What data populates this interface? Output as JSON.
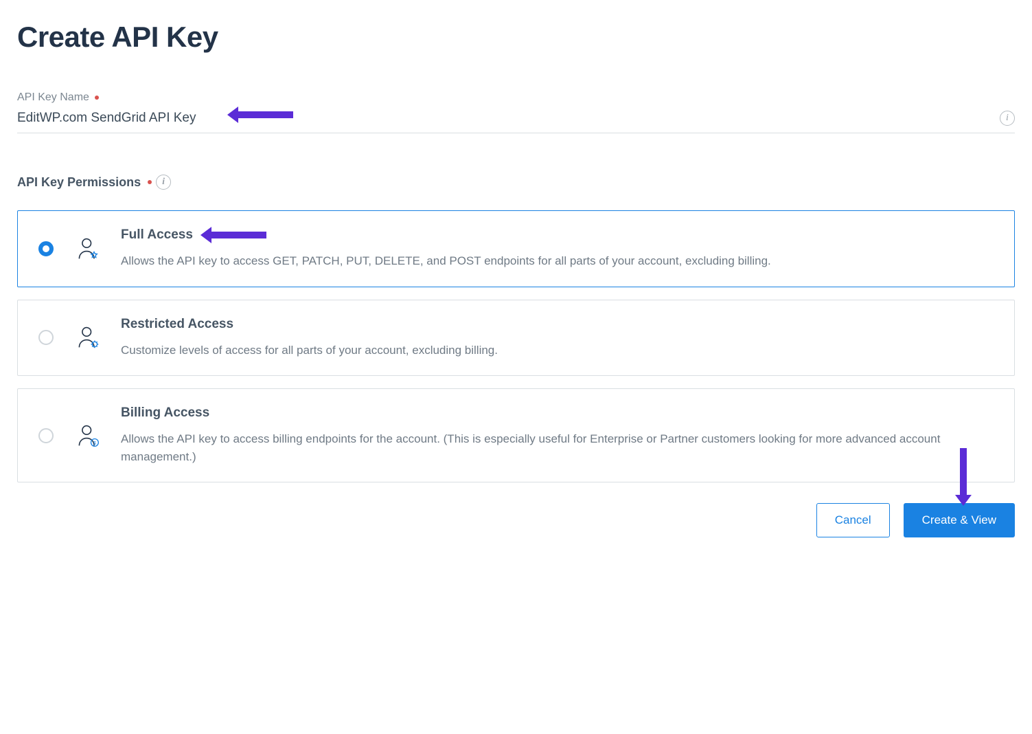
{
  "page": {
    "title": "Create API Key"
  },
  "fields": {
    "name_label": "API Key Name",
    "name_value": "EditWP.com SendGrid API Key"
  },
  "permissions": {
    "section_label": "API Key Permissions",
    "options": [
      {
        "id": "full",
        "title": "Full Access",
        "description": "Allows the API key to access GET, PATCH, PUT, DELETE, and POST endpoints for all parts of your account, excluding billing.",
        "selected": true
      },
      {
        "id": "restricted",
        "title": "Restricted Access",
        "description": "Customize levels of access for all parts of your account, excluding billing.",
        "selected": false
      },
      {
        "id": "billing",
        "title": "Billing Access",
        "description": "Allows the API key to access billing endpoints for the account. (This is especially useful for Enterprise or Partner customers looking for more advanced account management.)",
        "selected": false
      }
    ]
  },
  "actions": {
    "cancel": "Cancel",
    "create": "Create & View"
  },
  "colors": {
    "accent": "#1a82e2",
    "annotation": "#5b2cd6",
    "text_dark": "#233348"
  }
}
